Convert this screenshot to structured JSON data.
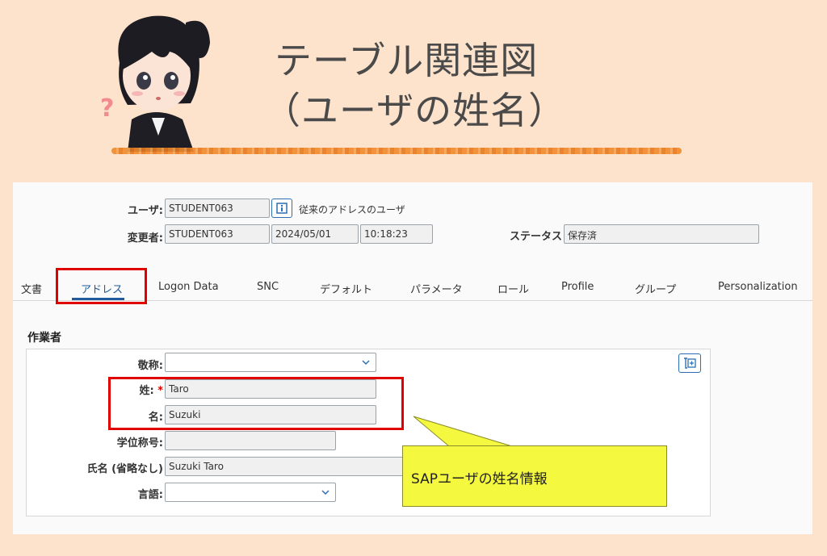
{
  "header": {
    "title_line1": "テーブル関連図",
    "title_line2": "（ユーザの姓名）"
  },
  "top_fields": {
    "user_label": "ユーザ:",
    "user_value": "STUDENT063",
    "user_desc": "従来のアドレスのユーザ",
    "changed_by_label": "変更者:",
    "changed_by_value": "STUDENT063",
    "date_value": "2024/05/01",
    "time_value": "10:18:23",
    "status_label": "ステータス",
    "status_value": "保存済"
  },
  "tabs": [
    {
      "label": "文書"
    },
    {
      "label": "アドレス",
      "active": true
    },
    {
      "label": "Logon Data"
    },
    {
      "label": "SNC"
    },
    {
      "label": "デフォルト"
    },
    {
      "label": "パラメータ"
    },
    {
      "label": "ロール"
    },
    {
      "label": "Profile"
    },
    {
      "label": "グループ"
    },
    {
      "label": "Personalization"
    }
  ],
  "section": {
    "title": "作業者",
    "title_label": "敬称:",
    "title_value": "",
    "last_name_label": "姓:",
    "last_name_required": "*",
    "last_name_value": "Taro",
    "first_name_label": "名:",
    "first_name_value": "Suzuki",
    "academic_title_label": "学位称号:",
    "academic_title_value": "",
    "full_name_label": "氏名 (省略なし)",
    "full_name_value": "Suzuki Taro",
    "language_label": "言語:",
    "language_value": ""
  },
  "callout": {
    "text": "SAPユーザの姓名情報"
  },
  "colors": {
    "background": "#fde3cc",
    "highlight_box": "#e00000",
    "callout_fill": "#f4f93f",
    "active_tab": "#1f5a9c"
  }
}
